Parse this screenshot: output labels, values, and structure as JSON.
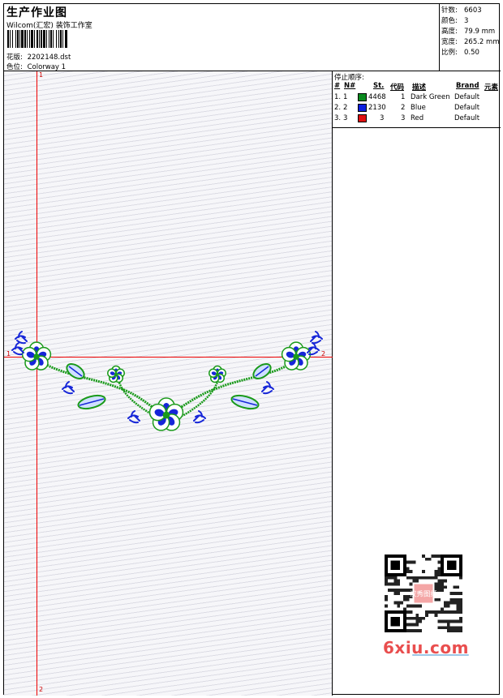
{
  "header": {
    "title": "生产作业图",
    "subtitle": "Wilcom(汇宏) 装饰工作室",
    "design_label": "花版:",
    "design_value": "2202148.dst",
    "colorway_label": "色位:",
    "colorway_value": "Colorway 1"
  },
  "stats": [
    {
      "label": "针数:",
      "value": "6603"
    },
    {
      "label": "颜色:",
      "value": "3"
    },
    {
      "label": "高度:",
      "value": "79.9 mm"
    },
    {
      "label": "宽度:",
      "value": "265.2 mm"
    },
    {
      "label": "比例:",
      "value": "0.50"
    }
  ],
  "axes": {
    "v_top": "1",
    "v_bottom": "2",
    "h_left": "1",
    "h_right": "2"
  },
  "stop_sequence": {
    "title": "停止顺序:",
    "columns": {
      "num": "#",
      "n": "N#",
      "st": "St.",
      "code": "代码",
      "desc": "描述",
      "brand": "Brand",
      "element": "元素"
    },
    "rows": [
      {
        "num": "1.",
        "n": "1",
        "st": "4468",
        "code": "1",
        "desc": "Dark Green",
        "brand": "Default",
        "color": "#0a8a1f"
      },
      {
        "num": "2.",
        "n": "2",
        "st": "2130",
        "code": "2",
        "desc": "Blue",
        "brand": "Default",
        "color": "#0b1fe0"
      },
      {
        "num": "3.",
        "n": "3",
        "st": "3",
        "code": "3",
        "desc": "Red",
        "brand": "Default",
        "color": "#e01010"
      }
    ]
  },
  "colors": {
    "green": "#1a9a1a",
    "blue": "#1626d8",
    "axis": "#ee0000",
    "watermark": "#e94e4e"
  },
  "watermark": {
    "text": "6xiu.com",
    "qr_logo": "汉秀图纸"
  }
}
